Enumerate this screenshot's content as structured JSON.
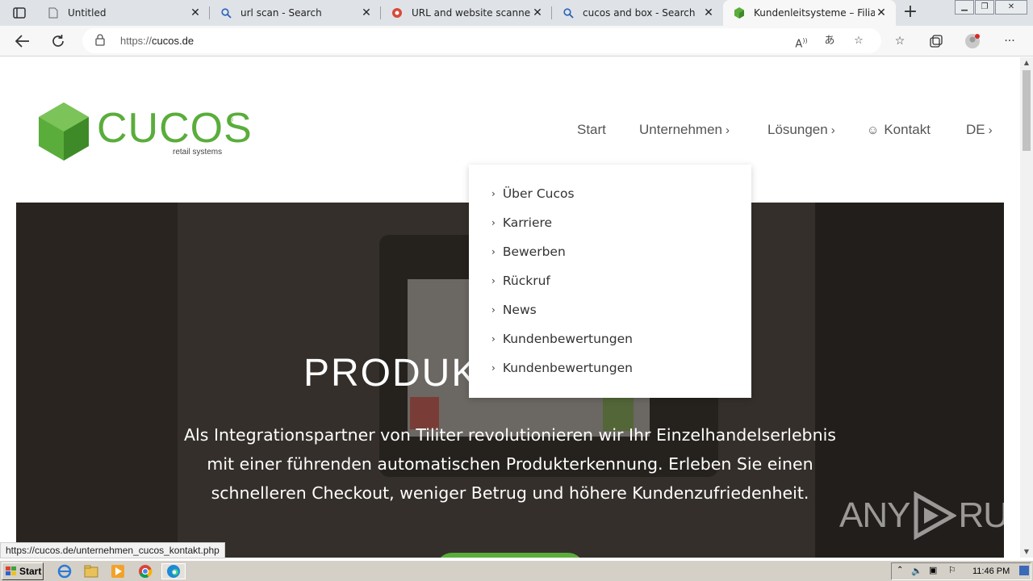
{
  "browser": {
    "tabs": [
      {
        "title": "Untitled",
        "icon": "page-icon",
        "active": false
      },
      {
        "title": "url scan - Search",
        "icon": "search-icon",
        "active": false
      },
      {
        "title": "URL and website scanner - u",
        "icon": "urlscan-icon",
        "active": false
      },
      {
        "title": "cucos and box - Search",
        "icon": "search-icon",
        "active": false
      },
      {
        "title": "Kundenleitsysteme – Filial F",
        "icon": "cucos-favicon",
        "active": true
      }
    ],
    "address": {
      "scheme": "https://",
      "host": "cucos.de"
    },
    "status_url": "https://cucos.de/unternehmen_cucos_kontakt.php"
  },
  "site": {
    "logo": {
      "word": "CUCOS",
      "registered": "®",
      "tagline": "retail systems",
      "brand_color": "#5aad3b"
    },
    "nav": {
      "start": "Start",
      "unternehmen": "Unternehmen",
      "loesungen": "Lösungen",
      "kontakt": "Kontakt",
      "lang": "DE"
    },
    "dropdown": [
      "Über Cucos",
      "Karriere",
      "Bewerben",
      "Rückruf",
      "News",
      "Kundenbewertungen",
      "Kundenbewertungen"
    ],
    "hero": {
      "title": "PRODUKT",
      "lines": [
        "Als Integrationspartner von Tiliter revolutionieren wir Ihr Einzelhandelserlebnis",
        "mit einer führenden automatischen Produkterkennung. Erleben Sie einen",
        "schnelleren Checkout, weniger Betrug und höhere Kundenzufriedenheit."
      ]
    },
    "watermark": {
      "left": "ANY",
      "right": "RUN"
    }
  },
  "taskbar": {
    "start_label": "Start",
    "apps": [
      "ie-icon",
      "explorer-icon",
      "media-player-icon",
      "chrome-icon",
      "edge-icon"
    ],
    "time": "11:46 PM"
  }
}
